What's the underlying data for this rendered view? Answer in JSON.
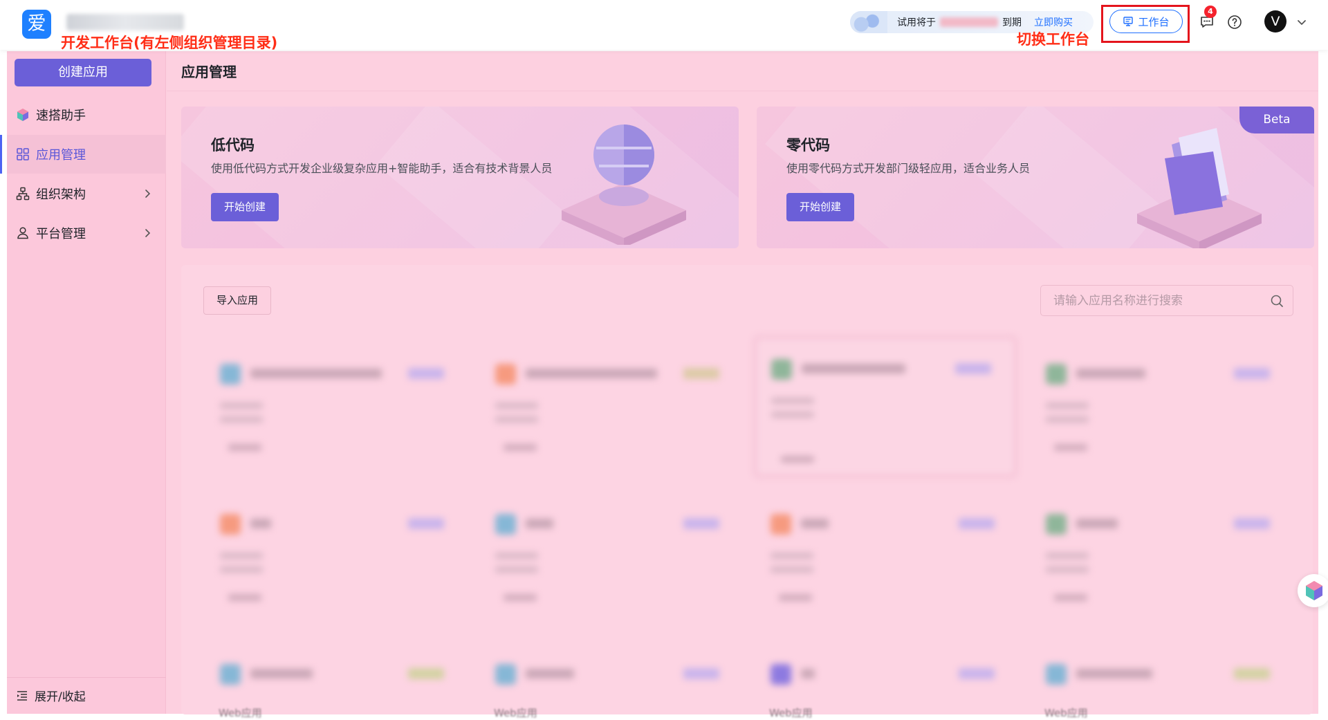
{
  "header": {
    "logo_char": "爱",
    "annotation_left": "开发工作台(有左侧组织管理目录)",
    "annotation_right": "切换工作台",
    "trial_prefix": "试用将于",
    "trial_suffix": "到期",
    "trial_buy": "立即购买",
    "workbench_label": "工作台",
    "notification_count": "4",
    "avatar_letter": "V"
  },
  "sidebar": {
    "create_button": "创建应用",
    "items": [
      {
        "label": "速搭助手"
      },
      {
        "label": "应用管理"
      },
      {
        "label": "组织架构"
      },
      {
        "label": "平台管理"
      }
    ],
    "collapse_label": "展开/收起"
  },
  "main": {
    "title": "应用管理",
    "cards": [
      {
        "title": "低代码",
        "desc": "使用低代码方式开发企业级复杂应用+智能助手，适合有技术背景人员",
        "button": "开始创建"
      },
      {
        "title": "零代码",
        "desc": "使用零代码方式开发部门级轻应用，适合业务人员",
        "button": "开始创建",
        "badge": "Beta"
      }
    ],
    "import_button": "导入应用",
    "search_placeholder": "请输入应用名称进行搜索",
    "web_labels": [
      "Web应用",
      "Web应用",
      "Web应用",
      "Web应用"
    ]
  },
  "colors": {
    "accent": "#6b5fd8",
    "link": "#1e6fff",
    "annotation": "#ff2d16",
    "overlay": "#fdd0e0"
  }
}
